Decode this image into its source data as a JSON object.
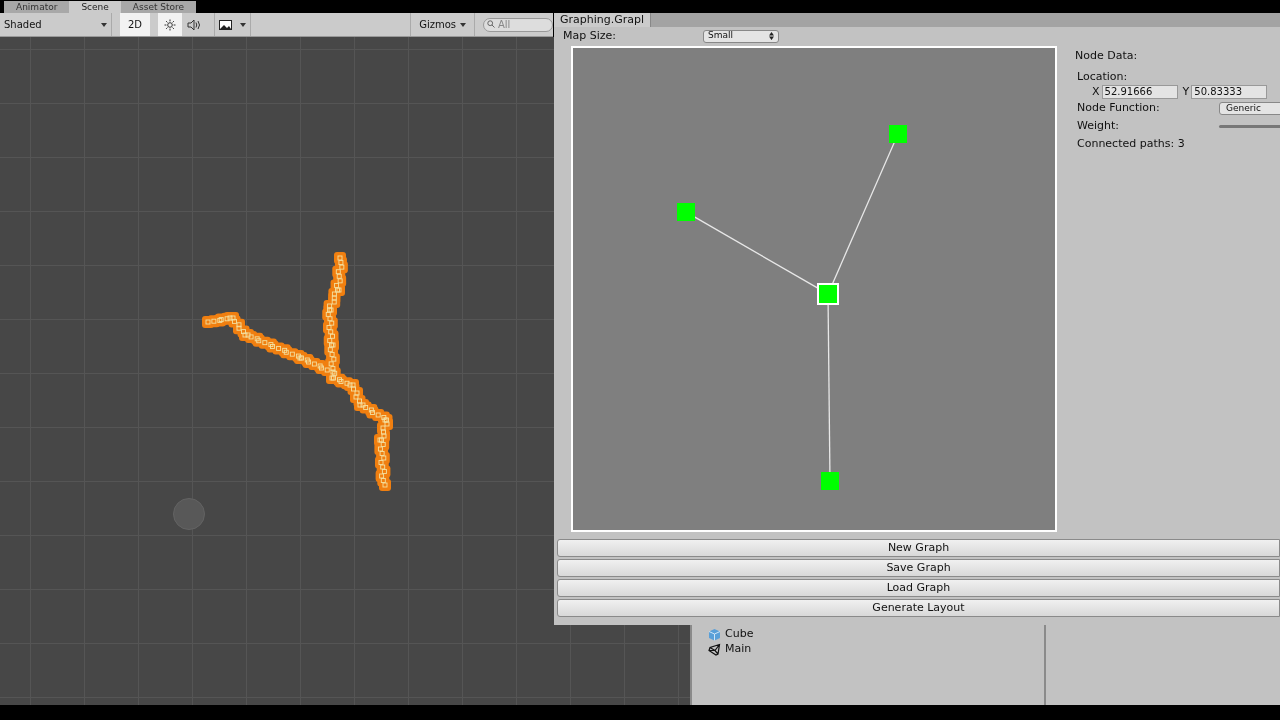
{
  "scene_tabs": [
    {
      "label": "Animator",
      "selected": false
    },
    {
      "label": "Scene",
      "selected": true
    },
    {
      "label": "Asset Store",
      "selected": false
    }
  ],
  "scene_toolbar": {
    "shading": "Shaded",
    "mode_2d": {
      "label": "2D",
      "on": true
    },
    "lighting_on": true,
    "audio_on": false,
    "gizmos": "Gizmos",
    "search": {
      "placeholder": "All"
    }
  },
  "graph_window": {
    "title": "Graphing.Grapl",
    "map_size_label": "Map Size:",
    "map_size": "Small",
    "nodes": [
      {
        "selected": false
      },
      {
        "selected": false
      },
      {
        "selected": true
      },
      {
        "selected": false
      }
    ],
    "node_data": {
      "heading": "Node Data:",
      "location_label": "Location:",
      "x_label": "X",
      "x_value": "52.91666",
      "y_label": "Y",
      "y_value": "50.83333",
      "function_label": "Node Function:",
      "function_value": "Generic",
      "weight_label": "Weight:",
      "connected": "Connected paths: 3"
    },
    "buttons": [
      "New Graph",
      "Save Graph",
      "Load Graph",
      "Generate Layout"
    ]
  },
  "hierarchy": [
    {
      "label": "Cube",
      "kind": "cube"
    },
    {
      "label": "Main",
      "kind": "camera"
    }
  ]
}
